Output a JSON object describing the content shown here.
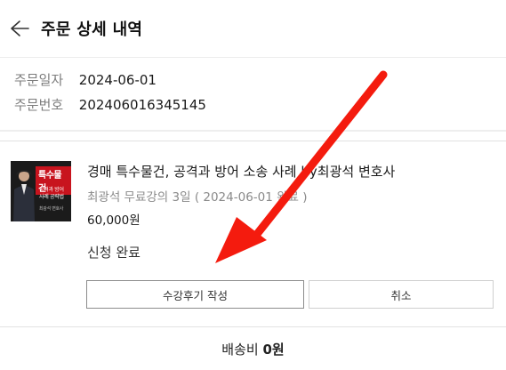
{
  "header": {
    "title": "주문 상세 내역",
    "back_icon": "arrow-left-icon"
  },
  "order": {
    "date_label": "주문일자",
    "date_value": "2024-06-01",
    "number_label": "주문번호",
    "number_value": "202406016345145"
  },
  "product": {
    "thumbnail": {
      "tag": "특수물건",
      "line1": "공격과 방어",
      "line2": "사례 공략법",
      "line3": "최광석 변호사"
    },
    "title": "경매 특수물건, 공격과 방어 소송 사례 by최광석 변호사",
    "subtitle": "최광석 무료강의 3일 ( 2024-06-01 완료 )",
    "price": "60,000원",
    "status": "신청 완료"
  },
  "actions": {
    "review_label": "수강후기 작성",
    "cancel_label": "취소"
  },
  "shipping": {
    "label": "배송비",
    "value": "0원"
  },
  "annotation": {
    "arrow_color": "#f41b0e"
  }
}
